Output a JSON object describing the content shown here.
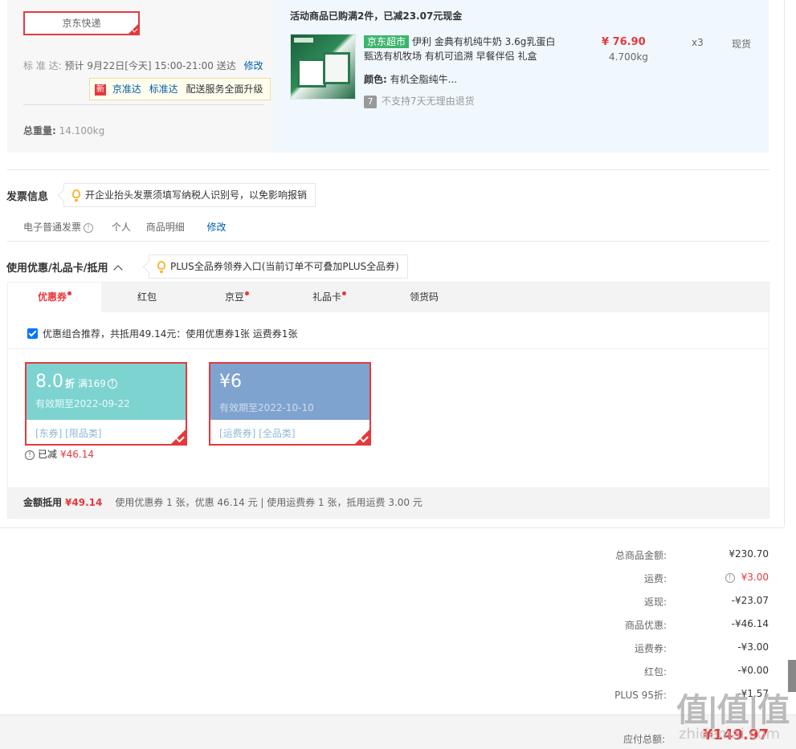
{
  "shipping": {
    "express_label": "京东快递",
    "std_label": "标 准 达:",
    "std_value": "预计 9月22日[今天] 15:00-21:00 送达",
    "modify": "修改",
    "tip_new": "新",
    "tip_jzd1": "京准达",
    "tip_jzd2": "标准达",
    "tip_text": "配送服务全面升级",
    "weight_label": "总重量:",
    "weight_value": "14.100kg"
  },
  "order_item": {
    "promo_title": "活动商品已购满2件，已减23.07元现金",
    "badge": "京东超市",
    "title": "伊利 金典有机纯牛奶 3.6g乳蛋白 甄选有机牧场 有机可追溯 早餐伴侣 礼盒",
    "color_label": "颜色:",
    "color_value": "有机全脂纯牛...",
    "return_icon": "7",
    "return_text": "不支持7天无理由退货",
    "price": "¥ 76.90",
    "weight": "4.700kg",
    "qty": "x3",
    "stock": "现货"
  },
  "invoice": {
    "title": "发票信息",
    "tip": "开企业抬头发票须填写纳税人识别号，以免影响报销",
    "type": "电子普通发票",
    "info_icon": "!",
    "holder": "个人",
    "content": "商品明细",
    "modify": "修改"
  },
  "coupons": {
    "title": "使用优惠/礼品卡/抵用",
    "tip": "PLUS全品券领券入口(当前订单不可叠加PLUS全品券)",
    "tabs": [
      {
        "label": "优惠券"
      },
      {
        "label": "红包"
      },
      {
        "label": "京豆"
      },
      {
        "label": "礼品卡"
      },
      {
        "label": "领货码"
      }
    ],
    "combo_text": "优惠组合推荐，共抵用49.14元：使用优惠券1张 运费券1张",
    "coupon1": {
      "amount": "8.0",
      "unit": "折",
      "condition": "满169",
      "valid": "有效期至2022-09-22",
      "tags": "[东券]  [限品类]"
    },
    "coupon2": {
      "amount": "¥6",
      "valid": "有效期至2022-10-10",
      "tags": "[运费券]  [全品类]"
    },
    "saved_label": "已减",
    "saved_value": "¥46.14",
    "deduct_label": "金额抵用",
    "deduct_value": "¥49.14",
    "deduct_detail": "使用优惠券 1 张，优惠 46.14 元  | 使用运费券 1 张，抵用运费 3.00 元"
  },
  "summary": {
    "rows": [
      {
        "label": "总商品金额:",
        "value": "¥230.70"
      },
      {
        "label": "运费:",
        "value": "¥3.00"
      },
      {
        "label": "返现:",
        "value": "-¥23.07"
      },
      {
        "label": "商品优惠:",
        "value": "-¥46.14"
      },
      {
        "label": "运费券:",
        "value": "-¥3.00"
      },
      {
        "label": "红包:",
        "value": "-¥0.00"
      },
      {
        "label": "PLUS 95折:",
        "value": "-¥1.57"
      }
    ],
    "pay_label": "应付总额:",
    "pay_value": "¥149.97"
  },
  "watermark": {
    "logo": "值|值|值",
    "site": "zhidemai.com"
  },
  "colors": {
    "accent_red": "#e4393c",
    "link_blue": "#005ea7",
    "coupon_teal": "#7dd3d0",
    "coupon_blue": "#7fa3cf",
    "jd_green": "#3eb46c"
  }
}
